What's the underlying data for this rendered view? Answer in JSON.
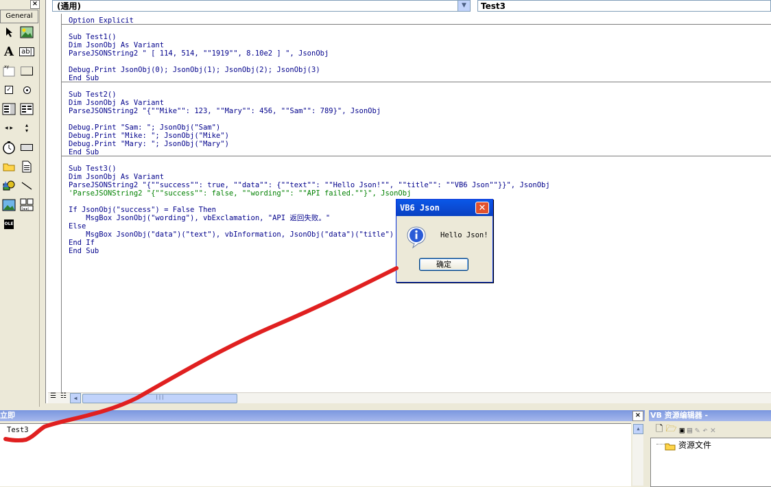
{
  "toolbox": {
    "tab_label": "General",
    "close_glyph": "×",
    "tools": [
      "pointer-icon",
      "picturebox-icon",
      "label-icon",
      "textbox-icon",
      "frame-icon",
      "commandbutton-icon",
      "checkbox-icon",
      "optionbutton-icon",
      "combobox-icon",
      "listbox-icon",
      "hscrollbar-icon",
      "vscrollbar-icon",
      "timer-icon",
      "drivelistbox-icon",
      "dirlistbox-icon",
      "filelistbox-icon",
      "shape-icon",
      "line-icon",
      "image-icon",
      "data-icon",
      "ole-icon"
    ]
  },
  "code_window": {
    "procedure_combo": "(通用)",
    "object_combo": "Test3",
    "lines_block1": [
      "Option Explicit"
    ],
    "lines_block2": [
      "Sub Test1()",
      "Dim JsonObj As Variant",
      "ParseJSONString2 \" [ 114, 514, \"\"1919\"\", 8.10e2 ] \", JsonObj",
      "",
      "Debug.Print JsonObj(0); JsonObj(1); JsonObj(2); JsonObj(3)",
      "End Sub"
    ],
    "lines_block3": [
      "Sub Test2()",
      "Dim JsonObj As Variant",
      "ParseJSONString2 \"{\"\"Mike\"\": 123, \"\"Mary\"\": 456, \"\"Sam\"\": 789}\", JsonObj",
      "",
      "Debug.Print \"Sam: \"; JsonObj(\"Sam\")",
      "Debug.Print \"Mike: \"; JsonObj(\"Mike\")",
      "Debug.Print \"Mary: \"; JsonObj(\"Mary\")",
      "End Sub"
    ],
    "lines_block4": [
      "Sub Test3()",
      "Dim JsonObj As Variant",
      "ParseJSONString2 \"{\"\"success\"\": true, \"\"data\"\": {\"\"text\"\": \"\"Hello Json!\"\", \"\"title\"\": \"\"VB6 Json\"\"}}\", JsonObj"
    ],
    "comment_line": "'ParseJSONString2 \"{\"\"success\"\": false, \"\"wording\"\": \"\"API failed.\"\"}\", JsonObj",
    "lines_block5": [
      "",
      "If JsonObj(\"success\") = False Then",
      "    MsgBox JsonObj(\"wording\"), vbExclamation, \"API 返回失败。\"",
      "Else",
      "    MsgBox JsonObj(\"data\")(\"text\"), vbInformation, JsonObj(\"data\")(\"title\")",
      "End If",
      "End Sub"
    ]
  },
  "immediate": {
    "title": "立即",
    "close_glyph": "×",
    "output": "Test3"
  },
  "resource_editor": {
    "title": "VB 资源编辑器 -",
    "tree_item": "资源文件"
  },
  "msgbox": {
    "title": "VB6 Json",
    "message": "Hello Json!",
    "ok_label": "确定",
    "close_glyph": "✕"
  },
  "annotation_color": "#e02020"
}
